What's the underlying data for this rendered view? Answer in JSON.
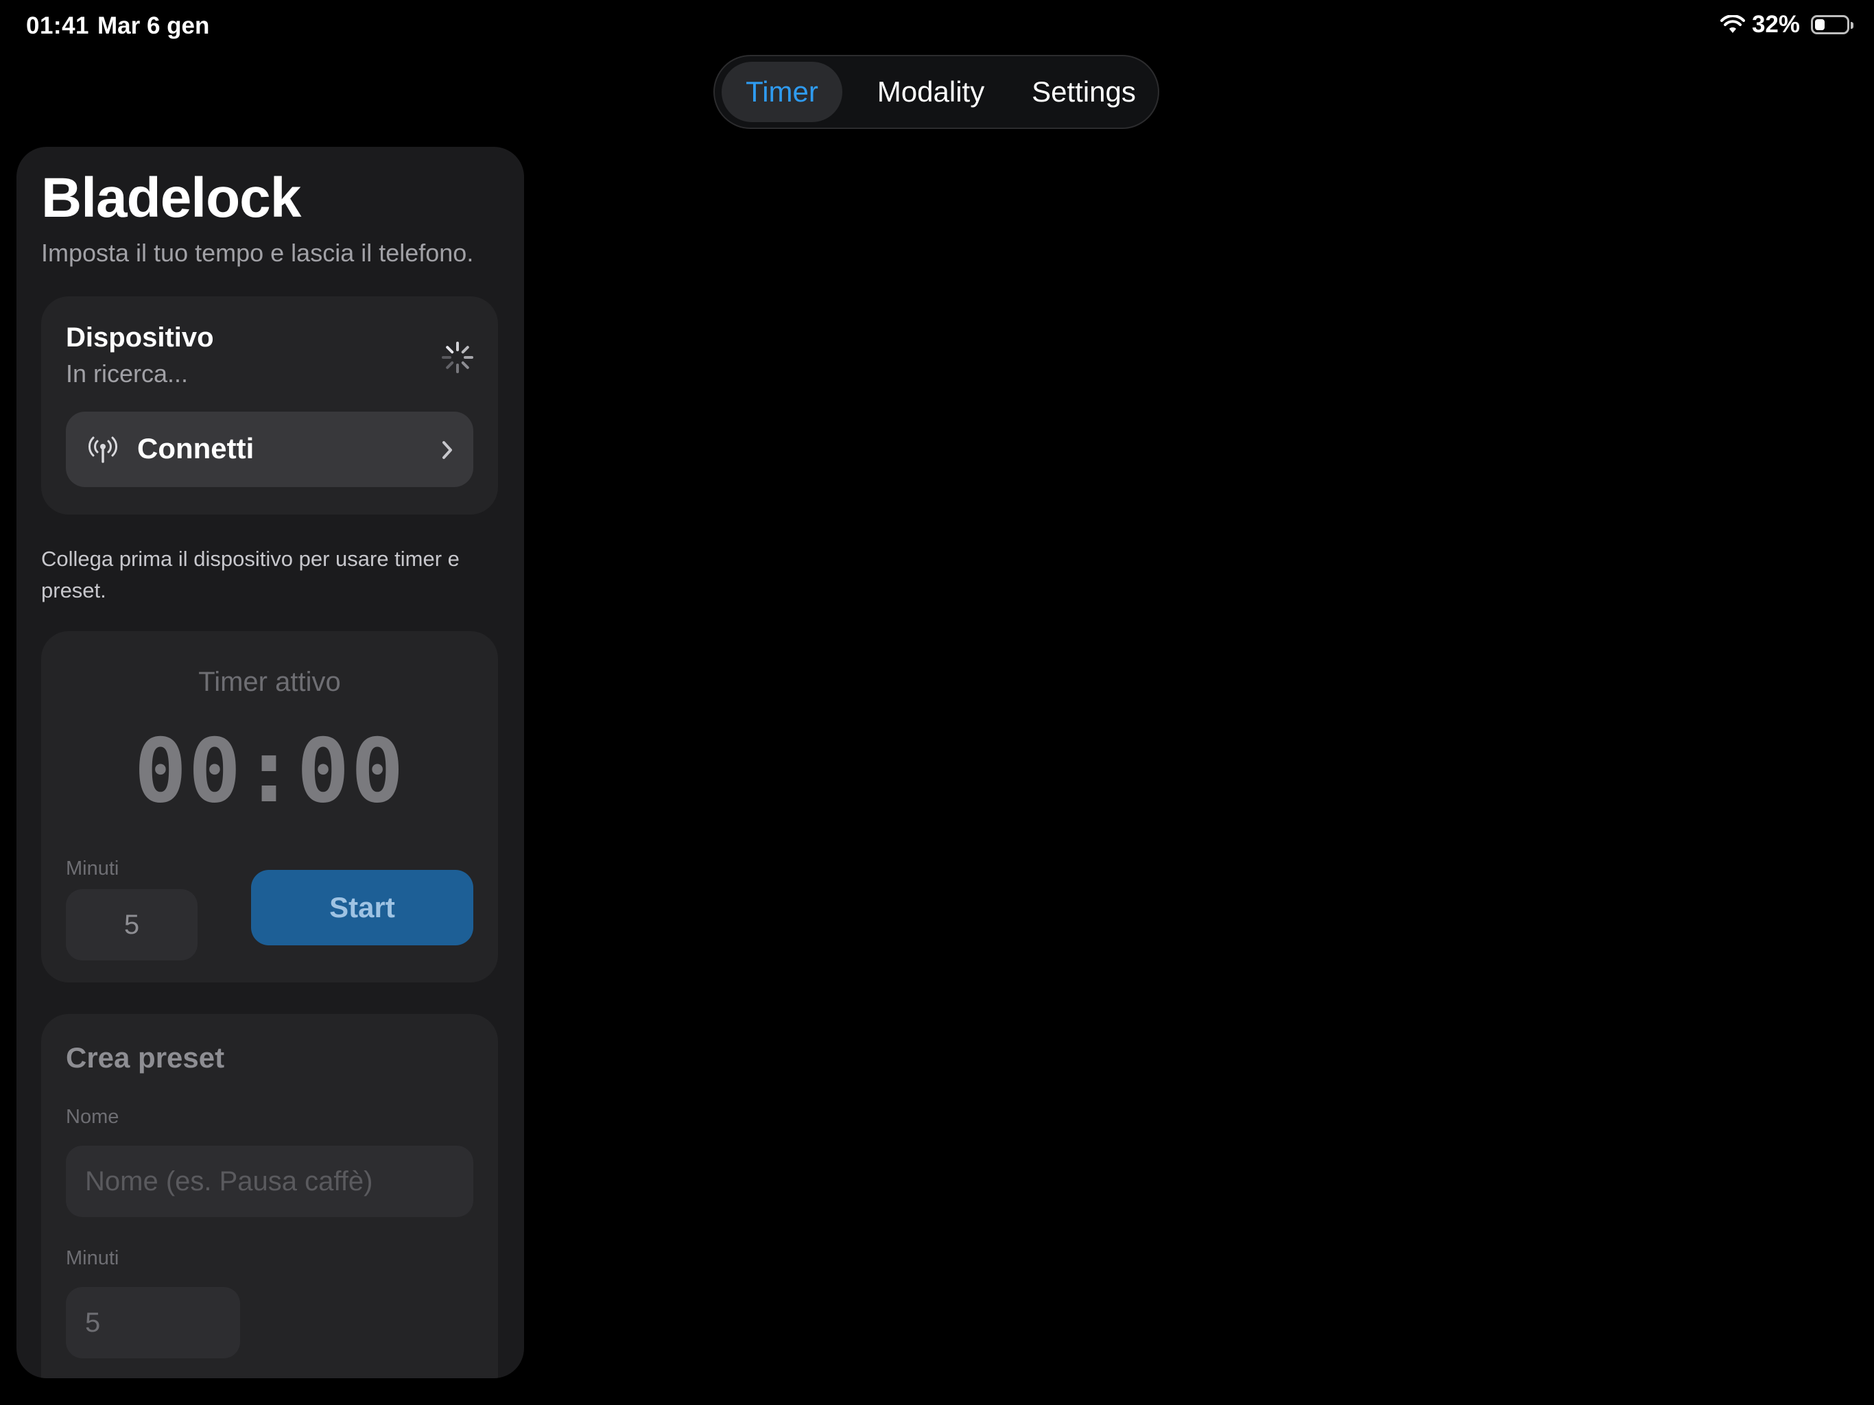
{
  "status_bar": {
    "time": "01:41",
    "date": "Mar 6 gen",
    "battery_percent": "32%",
    "battery_level": 0.32
  },
  "tabs": [
    {
      "label": "Timer",
      "selected": true
    },
    {
      "label": "Modality",
      "selected": false
    },
    {
      "label": "Settings",
      "selected": false
    }
  ],
  "app": {
    "title": "Bladelock",
    "subtitle": "Imposta il tuo tempo e lascia il telefono."
  },
  "device": {
    "title": "Dispositivo",
    "status": "In ricerca...",
    "connect_label": "Connetti"
  },
  "hint": "Collega prima il dispositivo per usare timer e preset.",
  "timer": {
    "label": "Timer attivo",
    "display": "00:00",
    "minutes_label": "Minuti",
    "minutes_value": "5",
    "start_label": "Start"
  },
  "preset": {
    "title": "Crea preset",
    "name_label": "Nome",
    "name_placeholder": "Nome (es. Pausa caffè)",
    "minutes_label": "Minuti",
    "minutes_value": "5"
  },
  "colors": {
    "accent": "#2f9bf0",
    "start_button": "#1d5f96",
    "panel": "#1b1b1d",
    "card": "#242426"
  },
  "icons": {
    "wifi": "wifi-icon",
    "battery": "battery-icon",
    "spinner": "loading-spinner-icon",
    "antenna": "antenna-icon",
    "chevron": "chevron-right-icon"
  }
}
